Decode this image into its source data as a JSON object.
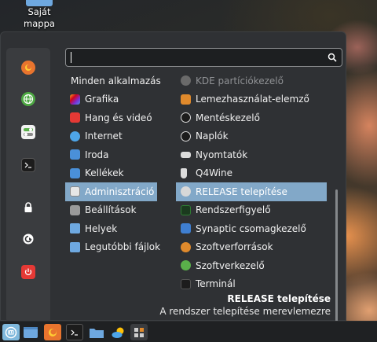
{
  "desktop": {
    "icon_label_line1": "Saját",
    "icon_label_line2": "mappa",
    "icon": "folder-icon"
  },
  "search": {
    "value": "",
    "placeholder": "",
    "icon": "search-icon"
  },
  "favorites": [
    {
      "name": "firefox",
      "icon": "firefox-icon",
      "color": "#e06c2c"
    },
    {
      "name": "browser",
      "icon": "globe-icon",
      "color": "#5ab04a"
    },
    {
      "name": "settings",
      "icon": "toggle-icon",
      "color": "#5ab04a"
    },
    {
      "name": "terminal",
      "icon": "terminal-icon",
      "color": "#222222"
    },
    {
      "name": "lock-screen",
      "icon": "lock-icon",
      "color": "#ffffff"
    },
    {
      "name": "logout",
      "icon": "logout-icon",
      "color": "#ffffff"
    },
    {
      "name": "shutdown",
      "icon": "power-icon",
      "color": "#e53935"
    }
  ],
  "categories": [
    {
      "label": "Minden alkalmazás",
      "icon": ""
    },
    {
      "label": "Grafika",
      "icon": "graphics-icon",
      "color": "#c95bd6"
    },
    {
      "label": "Hang és videó",
      "icon": "media-icon",
      "color": "#e53935"
    },
    {
      "label": "Internet",
      "icon": "cloud-icon",
      "color": "#4ea5e8"
    },
    {
      "label": "Iroda",
      "icon": "office-icon",
      "color": "#4a90d9"
    },
    {
      "label": "Kellékek",
      "icon": "tools-icon",
      "color": "#4a90d9"
    },
    {
      "label": "Adminisztráció",
      "icon": "admin-icon",
      "color": "#dcdcdc",
      "selected": true
    },
    {
      "label": "Beállítások",
      "icon": "settings-icon",
      "color": "#9a9a9a"
    },
    {
      "label": "Helyek",
      "icon": "folder-icon",
      "color": "#6ea8e0"
    },
    {
      "label": "Legutóbbi fájlok",
      "icon": "recent-folder-icon",
      "color": "#6ea8e0"
    }
  ],
  "apps": [
    {
      "label": "KDE partíciókezelő",
      "icon": "partition-icon",
      "color": "#7a7a7a",
      "dim": true
    },
    {
      "label": "Lemezhasználat-elemző",
      "icon": "disk-usage-icon",
      "color": "#e08a2c"
    },
    {
      "label": "Mentéskezelő",
      "icon": "backup-icon",
      "color": "#dcdcdc"
    },
    {
      "label": "Naplók",
      "icon": "logs-icon",
      "color": "#dcdcdc"
    },
    {
      "label": "Nyomtatók",
      "icon": "printer-icon",
      "color": "#dcdcdc"
    },
    {
      "label": "Q4Wine",
      "icon": "wine-icon",
      "color": "#dcdcdc"
    },
    {
      "label": "RELEASE telepítése",
      "icon": "install-icon",
      "color": "#c8c8c8",
      "selected": true
    },
    {
      "label": "Rendszerfigyelő",
      "icon": "monitor-icon",
      "color": "#2e7d32"
    },
    {
      "label": "Synaptic csomagkezelő",
      "icon": "synaptic-icon",
      "color": "#3f7fd1"
    },
    {
      "label": "Szoftverforrások",
      "icon": "sources-icon",
      "color": "#e08a2c"
    },
    {
      "label": "Szoftverkezelő",
      "icon": "software-icon",
      "color": "#5ab04a"
    },
    {
      "label": "Terminál",
      "icon": "terminal-icon",
      "color": "#222222"
    }
  ],
  "description": {
    "title": "RELEASE telepítése",
    "text": "A rendszer telepítése merevlemezre"
  },
  "taskbar": [
    {
      "name": "menu",
      "icon": "mint-menu-icon",
      "color": "#7fb8dc"
    },
    {
      "name": "show-desktop",
      "icon": "desktop-icon",
      "color": "#6ea8e0"
    },
    {
      "name": "firefox",
      "icon": "firefox-icon",
      "color": "#e06c2c"
    },
    {
      "name": "terminal",
      "icon": "terminal-icon",
      "color": "#222222"
    },
    {
      "name": "files",
      "icon": "folder-icon",
      "color": "#6ea8e0"
    },
    {
      "name": "weather",
      "icon": "weather-icon",
      "color": "#4ea5e8"
    },
    {
      "name": "calculator",
      "icon": "calculator-icon",
      "color": "#5a5a5a"
    }
  ],
  "colors": {
    "accent": "#82a8c8",
    "menu_bg": "#2f3134",
    "taskbar_bg": "#1f2123"
  }
}
